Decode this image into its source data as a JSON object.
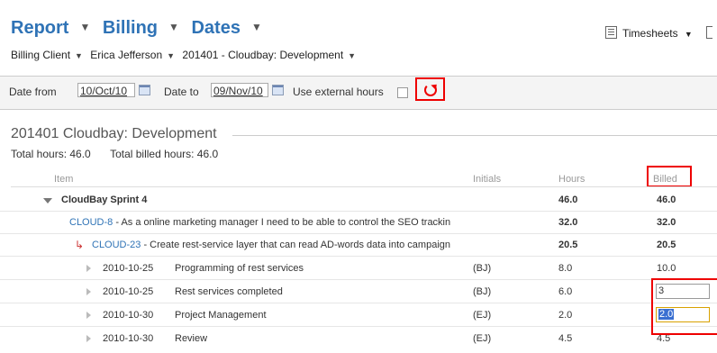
{
  "header": {
    "title_parts": [
      "Report",
      "Billing",
      "Dates"
    ],
    "crumbs": [
      "Billing Client",
      "Erica Jefferson",
      "201401 - Cloudbay: Development"
    ],
    "timesheets_label": "Timesheets"
  },
  "filters": {
    "date_from_label": "Date from",
    "date_from_value": "10/Oct/10",
    "date_to_label": "Date to",
    "date_to_value": "09/Nov/10",
    "external_hours_label": "Use external hours"
  },
  "section": {
    "title": "201401 Cloudbay: Development",
    "total_hours": "Total hours: 46.0",
    "total_billed": "Total billed hours: 46.0"
  },
  "columns": {
    "item": "Item",
    "initials": "Initials",
    "hours": "Hours",
    "billed": "Billed"
  },
  "rows": [
    {
      "item": "CloudBay Sprint 4",
      "initials": "",
      "hours": "46.0",
      "billed": "46.0"
    },
    {
      "key": "CLOUD-8",
      "summary": " - As a online marketing manager I need to be able to control the SEO trackin",
      "initials": "",
      "hours": "32.0",
      "billed": "32.0"
    },
    {
      "key": "CLOUD-23",
      "summary": " - Create rest-service layer that can read AD-words data into campaign",
      "initials": "",
      "hours": "20.5",
      "billed": "20.5"
    },
    {
      "date": "2010-10-25",
      "desc": "Programming of rest services",
      "initials": "(BJ)",
      "hours": "8.0",
      "billed": "10.0"
    },
    {
      "date": "2010-10-25",
      "desc": "Rest services completed",
      "initials": "(BJ)",
      "hours": "6.0",
      "billed": "3"
    },
    {
      "date": "2010-10-30",
      "desc": "Project Management",
      "initials": "(EJ)",
      "hours": "2.0",
      "billed": "2.0"
    },
    {
      "date": "2010-10-30",
      "desc": "Review",
      "initials": "(EJ)",
      "hours": "4.5",
      "billed": "4.5"
    }
  ]
}
